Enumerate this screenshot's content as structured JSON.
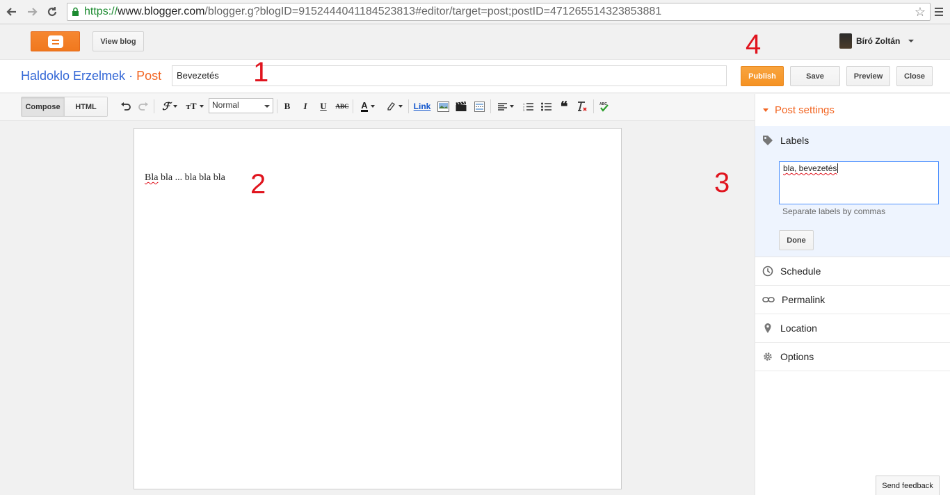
{
  "browser": {
    "url_protocol": "https://",
    "url_host": "www.blogger.com",
    "url_path": "/blogger.g?blogID=9152444041184523813#editor/target=post;postID=471265514323853881"
  },
  "topbar": {
    "view_blog": "View blog",
    "user_name": "Bíró Zoltán"
  },
  "post_header": {
    "blog_name": "Haldoklo Erzelmek",
    "separator": "·",
    "section": "Post",
    "title_value": "Bevezetés",
    "publish": "Publish",
    "save": "Save",
    "preview": "Preview",
    "close": "Close"
  },
  "toolbar": {
    "compose": "Compose",
    "html": "HTML",
    "format": "Normal",
    "link": "Link"
  },
  "editor": {
    "body_words": [
      "Bla",
      "bla",
      "...",
      "bla",
      "bla",
      "bla"
    ]
  },
  "sidebar": {
    "title": "Post settings",
    "labels": "Labels",
    "labels_value": "bla, bevezetés",
    "labels_hint": "Separate labels by commas",
    "done": "Done",
    "schedule": "Schedule",
    "permalink": "Permalink",
    "location": "Location",
    "options": "Options"
  },
  "annotations": [
    "1",
    "2",
    "3",
    "4"
  ],
  "feedback": "Send feedback",
  "colors": {
    "orange": "#f26522",
    "blue": "#3367d6",
    "marker_red": "#e0141e"
  }
}
